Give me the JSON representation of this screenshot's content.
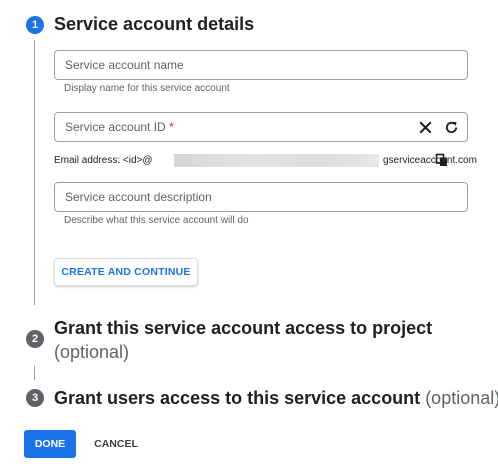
{
  "steps": [
    {
      "number": "1",
      "title": "Service account details",
      "optional": ""
    },
    {
      "number": "2",
      "title": "Grant this service account access to project",
      "optional": "(optional)"
    },
    {
      "number": "3",
      "title": "Grant users access to this service account",
      "optional": "(optional)"
    }
  ],
  "form": {
    "name_field": {
      "placeholder": "Service account name",
      "value": "",
      "hint": "Display name for this service account"
    },
    "id_field": {
      "placeholder": "Service account ID",
      "required_marker": "*",
      "value": ""
    },
    "email": {
      "label": "Email address: <id>@",
      "domain": "gserviceaccount.com"
    },
    "description_field": {
      "placeholder": "Service account description",
      "value": "",
      "hint": "Describe what this service account will do"
    },
    "create_button": "CREATE AND CONTINUE"
  },
  "footer": {
    "done_label": "DONE",
    "cancel_label": "CANCEL"
  },
  "colors": {
    "accent": "#1a73e8",
    "inactive_step": "#5f6368",
    "required": "#d93025"
  },
  "icons": {
    "clear": "close-icon",
    "refresh": "refresh-icon",
    "copy": "copy-icon"
  }
}
